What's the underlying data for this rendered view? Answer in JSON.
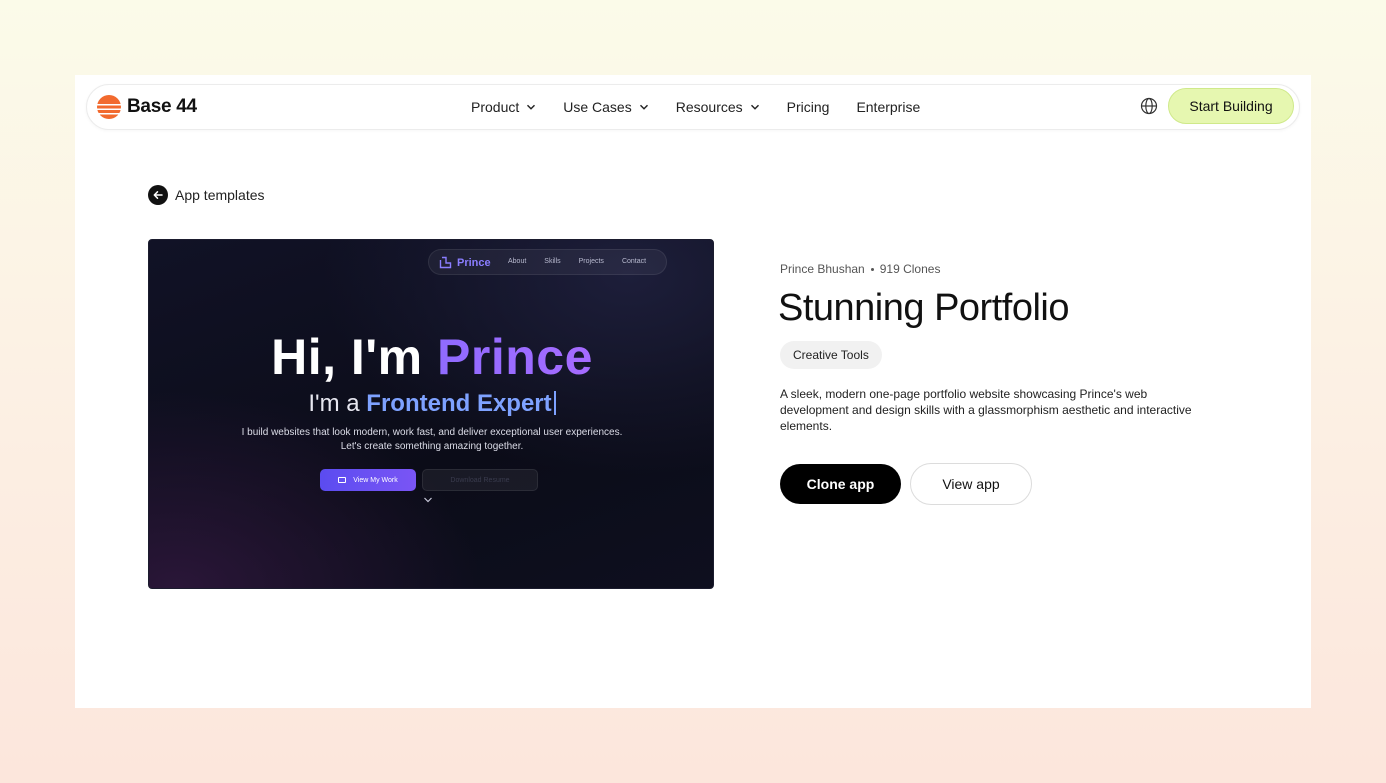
{
  "brand": {
    "name": "Base 44",
    "logo_icon": "sunset-stripes-icon",
    "logo_color": "#f26a2e"
  },
  "nav": {
    "items": [
      {
        "label": "Product",
        "dropdown": true
      },
      {
        "label": "Use Cases",
        "dropdown": true
      },
      {
        "label": "Resources",
        "dropdown": true
      },
      {
        "label": "Pricing",
        "dropdown": false
      },
      {
        "label": "Enterprise",
        "dropdown": false
      }
    ],
    "globe_icon": "globe-icon",
    "cta_label": "Start Building",
    "cta_color": "#e6f7b0"
  },
  "back": {
    "label": "App templates",
    "icon": "arrow-left-icon"
  },
  "preview": {
    "nav_brand": "Prince",
    "nav_links": [
      "About",
      "Skills",
      "Projects",
      "Contact"
    ],
    "hero_prefix": "Hi, I'm ",
    "hero_name": "Prince",
    "sub_prefix": "I'm a ",
    "sub_role": "Frontend Expert",
    "desc_line1": "I build websites that look modern, work fast, and deliver exceptional user experiences.",
    "desc_line2": "Let's create something amazing together.",
    "primary_button": "View My Work",
    "secondary_button": "Download Resume"
  },
  "app": {
    "author": "Prince Bhushan",
    "clones": "919 Clones",
    "title": "Stunning Portfolio",
    "tag": "Creative Tools",
    "description": "A sleek, modern one-page portfolio website showcasing Prince's web development and design skills with a glassmorphism aesthetic and interactive elements.",
    "clone_button": "Clone app",
    "view_button": "View app"
  }
}
